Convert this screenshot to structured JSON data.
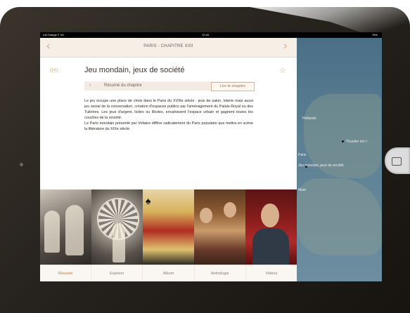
{
  "status_bar": {
    "carrier": "•ull Orange F 3G",
    "time": "12:40",
    "battery": "76%"
  },
  "header": {
    "title": "PARIS - CHAPITRE XXII",
    "back_icon": "chevron-left-icon",
    "forward_icon": "chevron-right-icon"
  },
  "article": {
    "audio_icon": "broadcast-icon",
    "favorite_icon": "star-icon",
    "heading": "Jeu mondain, jeux de société",
    "summary_label": "Résumé du chapitre",
    "read_button": "Lire le chapitre",
    "paragraph1": "Le jeu occupe une place de choix dans le Paris du XVIIIe siècle : jeux de salon, loterie mais aussi jeu social de la conversation, création d'espaces publics par l'aménagement du Palais-Royal ou des Tuileries. Les jeux d'argent, licites ou illicites, envahissent l'espace urbain et gagnent toutes les couches de la société.",
    "paragraph2": "Le Paris mondain présenté par Voltaire diffère radicalement du Paris populaire que mettra en scène la littérature du XIXe siècle."
  },
  "images": [
    {
      "name": "engraving-image"
    },
    {
      "name": "wheel-engraving-image"
    },
    {
      "name": "playing-card-image"
    },
    {
      "name": "painting-image"
    },
    {
      "name": "video-presenter-image"
    }
  ],
  "tabs": [
    {
      "label": "Résumé",
      "active": true
    },
    {
      "label": "Explorer",
      "active": false
    },
    {
      "label": "Album",
      "active": false
    },
    {
      "label": "Anthologie",
      "active": false
    },
    {
      "label": "Vidéos",
      "active": false
    }
  ],
  "map": {
    "labels": [
      "Hollande",
      "Thunder ten t",
      "Paris",
      "Jeu mondain, jeux de société",
      "Mare"
    ]
  },
  "colors": {
    "accent": "#d2aa70",
    "panel_header": "#f6efe8",
    "map_water": "#5b7f93"
  }
}
